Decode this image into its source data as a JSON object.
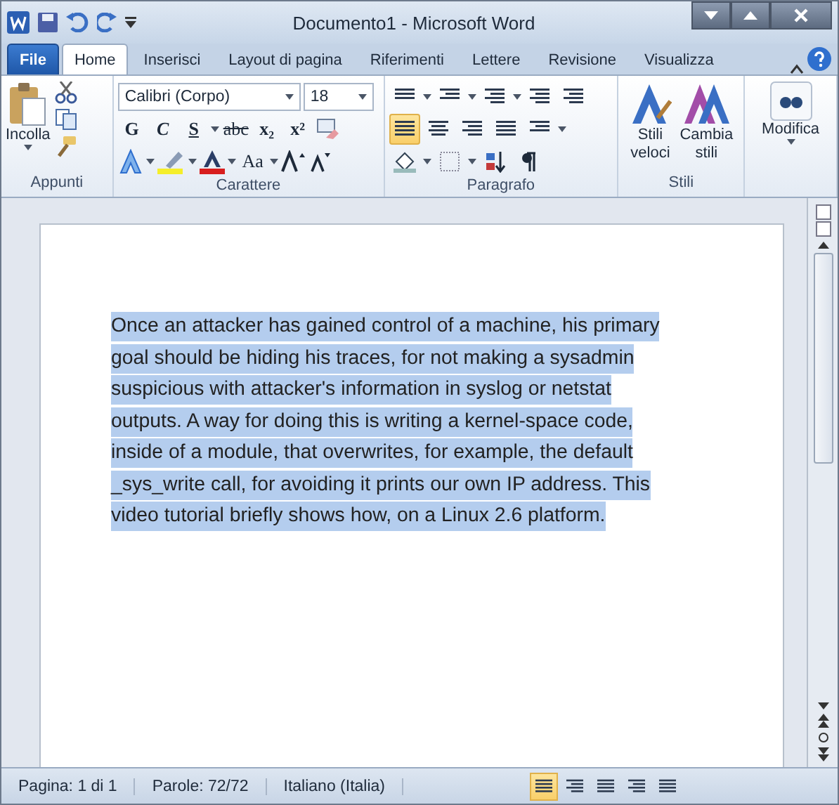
{
  "window": {
    "title": "Documento1  -  Microsoft Word"
  },
  "tabs": [
    {
      "label": "File",
      "kind": "file",
      "selected": false
    },
    {
      "label": "Home",
      "kind": "tab",
      "selected": true
    },
    {
      "label": "Inserisci",
      "kind": "tab",
      "selected": false
    },
    {
      "label": "Layout di pagina",
      "kind": "tab",
      "selected": false
    },
    {
      "label": "Riferimenti",
      "kind": "tab",
      "selected": false
    },
    {
      "label": "Lettere",
      "kind": "tab",
      "selected": false
    },
    {
      "label": "Revisione",
      "kind": "tab",
      "selected": false
    },
    {
      "label": "Visualizza",
      "kind": "tab",
      "selected": false
    }
  ],
  "ribbon": {
    "clipboard": {
      "label": "Appunti",
      "paste": "Incolla"
    },
    "font": {
      "label": "Carattere",
      "font_name": "Calibri (Corpo)",
      "font_size": "18",
      "bold": "G",
      "italic": "C",
      "underline": "S",
      "strike": "abc",
      "subscript": "x₂",
      "superscript": "x²",
      "case": "Aa"
    },
    "paragraph": {
      "label": "Paragrafo",
      "align": [
        {
          "selected": true
        },
        {
          "selected": false
        },
        {
          "selected": false
        },
        {
          "selected": false
        }
      ]
    },
    "styles": {
      "label": "Stili",
      "quick": [
        "Stili",
        "veloci"
      ],
      "change": [
        "Cambia",
        "stili"
      ]
    },
    "editing": {
      "label": "Modifica"
    }
  },
  "document": {
    "selected": true,
    "lines": [
      "Once an attacker has gained control of a machine, his primary",
      "goal should be hiding his traces, for not making a sysadmin",
      "suspicious with attacker's information in syslog or netstat",
      "outputs.  A way for doing this is writing a kernel-space code,",
      "inside of a module, that overwrites, for example, the default",
      "_sys_write call, for avoiding it prints our own IP address. This",
      "video tutorial briefly shows how, on a Linux 2.6 platform."
    ]
  },
  "status_bar": {
    "items": [
      "Pagina: 1 di 1",
      "Parole: 72/72",
      "Italiano (Italia)"
    ],
    "views": [
      {
        "selected": true
      },
      {
        "selected": false
      },
      {
        "selected": false
      },
      {
        "selected": false
      },
      {
        "selected": false
      }
    ]
  }
}
